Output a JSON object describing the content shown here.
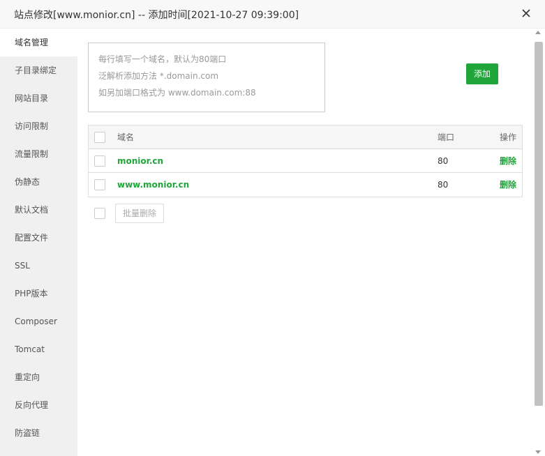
{
  "dialog": {
    "title": "站点修改[www.monior.cn] -- 添加时间[2021-10-27 09:39:00]"
  },
  "sidebar": {
    "items": [
      {
        "label": "域名管理",
        "active": true
      },
      {
        "label": "子目录绑定"
      },
      {
        "label": "网站目录"
      },
      {
        "label": "访问限制"
      },
      {
        "label": "流量限制"
      },
      {
        "label": "伪静态"
      },
      {
        "label": "默认文档"
      },
      {
        "label": "配置文件"
      },
      {
        "label": "SSL"
      },
      {
        "label": "PHP版本"
      },
      {
        "label": "Composer"
      },
      {
        "label": "Tomcat"
      },
      {
        "label": "重定向"
      },
      {
        "label": "反向代理"
      },
      {
        "label": "防盗链"
      }
    ]
  },
  "domain_input": {
    "placeholder_lines": [
      "每行填写一个域名，默认为80端口",
      "泛解析添加方法 *.domain.com",
      "如另加端口格式为 www.domain.com:88"
    ],
    "add_label": "添加"
  },
  "table": {
    "headers": {
      "domain": "域名",
      "port": "端口",
      "action": "操作"
    },
    "rows": [
      {
        "domain": "monior.cn",
        "port": "80",
        "action": "删除"
      },
      {
        "domain": "www.monior.cn",
        "port": "80",
        "action": "删除"
      }
    ]
  },
  "batch": {
    "delete_label": "批量删除"
  },
  "colors": {
    "accent": "#20a53a",
    "sidebar_bg": "#f0f0f0"
  }
}
